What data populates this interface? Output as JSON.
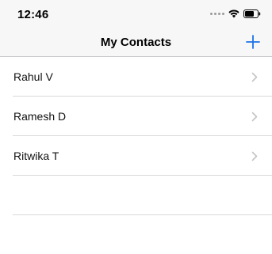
{
  "status_bar": {
    "time": "12:46"
  },
  "nav": {
    "title": "My Contacts",
    "add_icon": "plus-icon"
  },
  "colors": {
    "accent": "#1a73e8",
    "chevron": "#c4c4c7",
    "separator": "#d9d9d9",
    "bar_background": "#f7f7f7"
  },
  "contacts": [
    {
      "name": "Rahul V"
    },
    {
      "name": "Ramesh D"
    },
    {
      "name": "Ritwika T"
    }
  ]
}
